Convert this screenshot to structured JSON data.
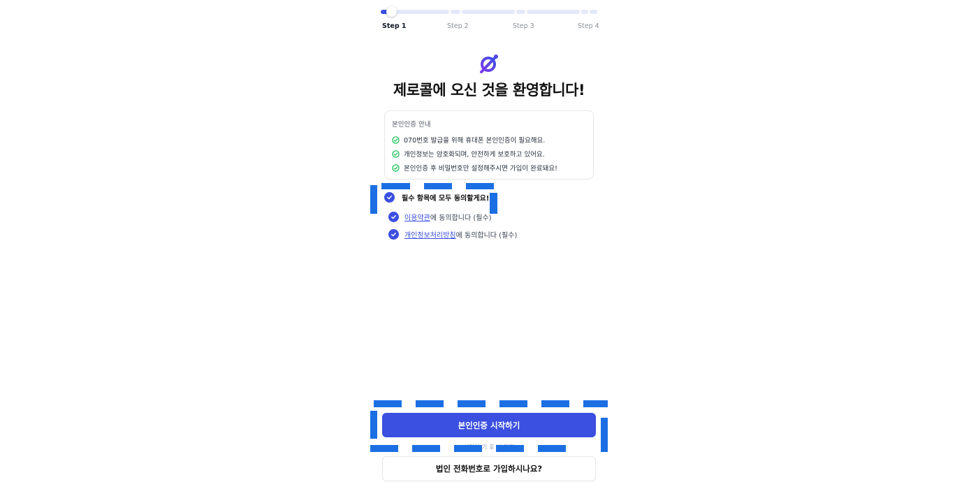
{
  "progress": {
    "current_step": 1,
    "steps": [
      "Step 1",
      "Step 2",
      "Step 3",
      "Step 4"
    ],
    "accent_color": "#3b4fe0"
  },
  "logo": {
    "icon": "zerocall-logo-icon"
  },
  "title": "제로콜에 오신 것을 환영합니다!",
  "info_card": {
    "title": "본인인증 안내",
    "items": [
      "070번호 발급을 위해 휴대폰 본인인증이 필요해요.",
      "개인정보는 암호화되며, 안전하게 보호하고 있어요.",
      "본인인증 후 비밀번호만 설정해주시면 가입이 완료돼요!"
    ],
    "check_color": "#22c55e"
  },
  "agreements": {
    "all_label": "필수 항목에 모두 동의할게요!",
    "items": [
      {
        "link": "이용약관",
        "suffix": "에 동의합니다 (필수)",
        "checked": true
      },
      {
        "link": "개인정보처리방침",
        "suffix": "에 동의합니다 (필수)",
        "checked": true
      }
    ]
  },
  "primary_button": {
    "label": "본인인증 시작하기"
  },
  "footer_note": "회원인 기 후 법 간편",
  "secondary_button": {
    "label": "법인 전화번호로 가입하시나요?"
  },
  "highlight_color": "#1b6fe3"
}
